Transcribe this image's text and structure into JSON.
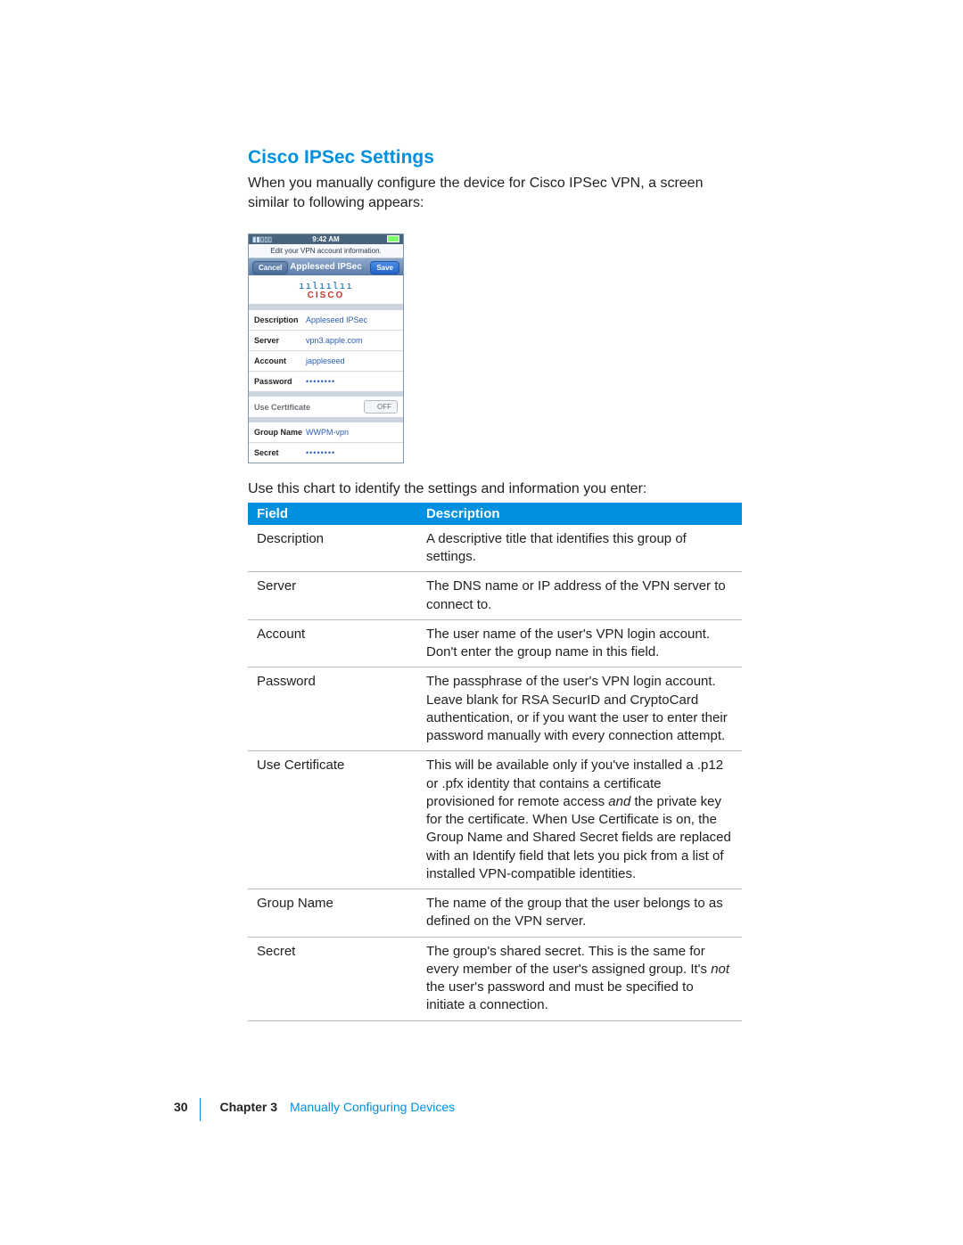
{
  "heading": "Cisco IPSec Settings",
  "intro": "When you manually configure the device for Cisco IPSec VPN, a screen similar to following appears:",
  "after_shot": "Use this chart to identify the settings and information you enter:",
  "shot": {
    "time": "9:42 AM",
    "subtitle": "Edit your VPN account information.",
    "title": "Appleseed IPSec",
    "cancel": "Cancel",
    "save": "Save",
    "logo_bars": "ıılıılıı",
    "logo_word": "CISCO",
    "rows": {
      "description_label": "Description",
      "description_value": "Appleseed IPSec",
      "server_label": "Server",
      "server_value": "vpn3.apple.com",
      "account_label": "Account",
      "account_value": "jappleseed",
      "password_label": "Password",
      "password_value": "••••••••",
      "usecert_label": "Use Certificate",
      "usecert_switch": "OFF",
      "group_label": "Group Name",
      "group_value": "WWPM-vpn",
      "secret_label": "Secret",
      "secret_value": "••••••••"
    }
  },
  "table": {
    "head_field": "Field",
    "head_desc": "Description",
    "rows": [
      {
        "field": "Description",
        "desc": "A descriptive title that identifies this group of settings."
      },
      {
        "field": "Server",
        "desc": "The DNS name or IP address of the VPN server to connect to."
      },
      {
        "field": "Account",
        "desc": "The user name of the user's VPN login account. Don't enter the group name in this field."
      },
      {
        "field": "Password",
        "desc": "The passphrase of the user's VPN login account. Leave blank for RSA SecurID and CryptoCard authentication, or if you want the user to enter their password manually with every connection attempt."
      },
      {
        "field": "Use Certificate",
        "desc_parts": {
          "a": "This will be available only if you've installed a .p12 or .pfx identity that contains a certificate provisioned for remote access ",
          "em": "and",
          "b": " the private key for the certificate. When Use Certificate is on, the Group Name and Shared Secret fields are replaced with an Identify field that lets you pick from a list of installed VPN-compatible identities."
        }
      },
      {
        "field": "Group Name",
        "desc": "The name of the group that the user belongs to as defined on the VPN server."
      },
      {
        "field": "Secret",
        "desc_parts": {
          "a": "The group's shared secret. This is the same for every member of the user's assigned group. It's ",
          "em": "not",
          "b": " the user's password and must be specified to initiate a connection."
        }
      }
    ]
  },
  "footer": {
    "page": "30",
    "chapter_label": "Chapter 3",
    "chapter_name": "Manually Configuring Devices"
  }
}
